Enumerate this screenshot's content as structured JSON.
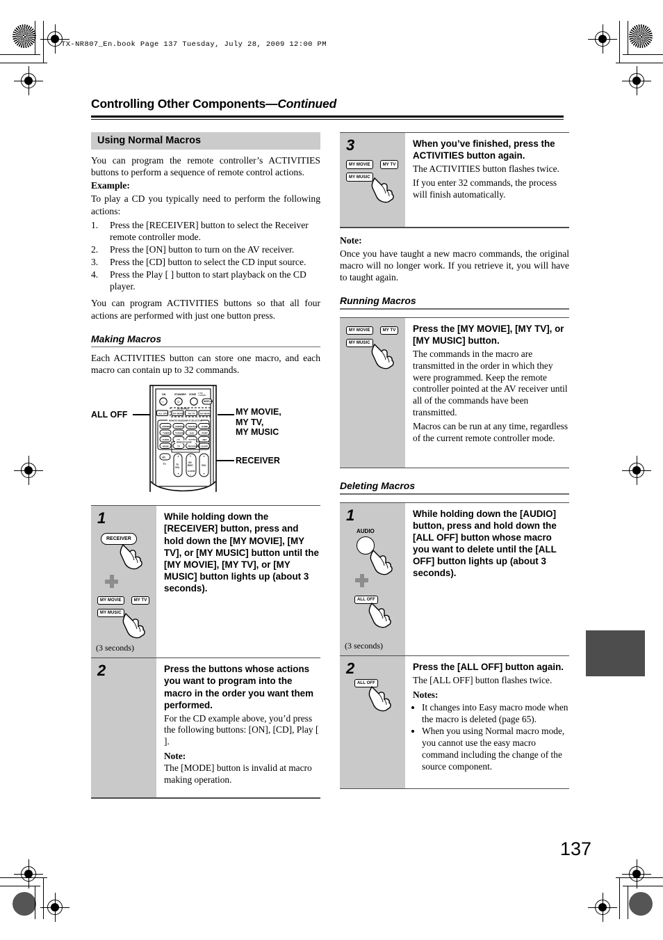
{
  "print_header": "TX-NR807_En.book   Page 137   Tuesday, July 28, 2009   12:00 PM",
  "page_number": "137",
  "chapter": {
    "title": "Controlling Other Components",
    "continued": "—Continued"
  },
  "left_column": {
    "section_title": "Using Normal Macros",
    "intro": "You can program the remote controller’s ACTIVITIES buttons to perform a sequence of remote control actions.",
    "example_label": "Example:",
    "example_intro": "To play a CD you typically need to perform the following actions:",
    "example_steps": [
      {
        "num": "1.",
        "text": "Press the [RECEIVER] button to select the Receiver remote controller mode."
      },
      {
        "num": "2.",
        "text": "Press the [ON] button to turn on the AV receiver."
      },
      {
        "num": "3.",
        "text": "Press the [CD] button to select the CD input source."
      },
      {
        "num": "4.",
        "text": "Press the Play [     ] button to start playback on the CD player."
      }
    ],
    "example_outro": "You can program ACTIVITIES buttons so that all four actions are performed with just one button press.",
    "making_macros": {
      "heading": "Making Macros",
      "text": "Each ACTIVITIES button can store one macro, and each macro can contain up to 32 commands."
    },
    "remote_diagram": {
      "label_all_off": "ALL OFF",
      "label_activities": "MY MOVIE,\nMY TV,\nMY MUSIC",
      "label_receiver": "RECEIVER",
      "top_row_labels": [
        "ON",
        "STANDBY",
        "ZONE",
        "DISPLAY"
      ],
      "zone_sub": "2 / 3 IND.\nGREEN",
      "activities_caption": "ACTIVITIES",
      "selector_caption": "REMOTE MODE/INPUT SELECTOR",
      "mode_caption": "REMOTE MODE",
      "buttons": {
        "all_off": "ALL OFF",
        "my_movie": "MY MOVIE",
        "my_tv": "MY TV",
        "my_music": "MY MUSIC",
        "row1": [
          "DVD/BD",
          "VCR/DVR",
          "CBL/SAT",
          "GAME"
        ],
        "row2": [
          "TUNER",
          "TV/TAPE",
          "AUX",
          "PORT"
        ],
        "row3": [
          "AUDIO",
          "CD",
          "PHONO",
          "NET"
        ],
        "row4": [
          "MODE",
          "TV",
          "RECEIVER",
          "SLEEP"
        ],
        "bottom": [
          "I/⏻",
          "TV",
          "TV VOL",
          "CH DISC",
          "ALBUM",
          "VOL"
        ]
      }
    },
    "step1": {
      "num": "1",
      "heading": "While holding down the [RECEIVER] button, press and hold down the [MY MOVIE], [MY TV], or [MY MUSIC] button until the [MY MOVIE], [MY TV], or [MY MUSIC] button lights up (about 3 seconds).",
      "icon_receiver": "RECEIVER",
      "icon_my_movie": "MY MOVIE",
      "icon_my_tv": "MY TV",
      "icon_my_music": "MY MUSIC",
      "caption": "(3 seconds)"
    },
    "step2": {
      "num": "2",
      "heading": "Press the buttons whose actions you want to program into the macro in the order you want them performed.",
      "body": "For the CD example above, you’d press the following buttons: [ON], [CD], Play [     ].",
      "note_label": "Note:",
      "note": "The [MODE] button is invalid at macro making operation."
    }
  },
  "right_column": {
    "step3": {
      "num": "3",
      "heading": "When you’ve finished, press the ACTIVITIES button again.",
      "body1": "The ACTIVITIES button flashes twice.",
      "body2": "If you enter 32 commands, the process will finish automatically.",
      "icon_my_movie": "MY MOVIE",
      "icon_my_tv": "MY TV",
      "icon_my_music": "MY MUSIC"
    },
    "note_label": "Note:",
    "note_text": "Once you have taught a new macro commands, the original macro will no longer work. If you retrieve it, you will have to taught again.",
    "running_macros": {
      "heading": "Running Macros",
      "step": {
        "heading": "Press the [MY MOVIE], [MY TV], or [MY MUSIC] button.",
        "body1": "The commands in the macro are transmitted in the order in which they were programmed. Keep the remote controller pointed at the AV receiver until all of the commands have been transmitted.",
        "body2": "Macros can be run at any time, regardless of the current remote controller mode.",
        "icon_my_movie": "MY MOVIE",
        "icon_my_tv": "MY TV",
        "icon_my_music": "MY MUSIC"
      }
    },
    "deleting_macros": {
      "heading": "Deleting Macros",
      "step1": {
        "num": "1",
        "heading": "While holding down the [AUDIO] button, press and hold down the [ALL OFF] button whose macro you want to delete until the [ALL OFF] button lights up (about 3 seconds).",
        "icon_audio": "AUDIO",
        "icon_all_off": "ALL OFF",
        "caption": "(3 seconds)"
      },
      "step2": {
        "num": "2",
        "heading": "Press the [ALL OFF] button again.",
        "body": "The [ALL OFF] button flashes twice.",
        "notes_label": "Notes:",
        "notes": [
          "It changes into Easy macro mode when the macro is deleted (page 65).",
          "When you using Normal macro mode, you cannot use the easy macro command including the change of the source component."
        ],
        "icon_all_off": "ALL OFF"
      }
    }
  }
}
